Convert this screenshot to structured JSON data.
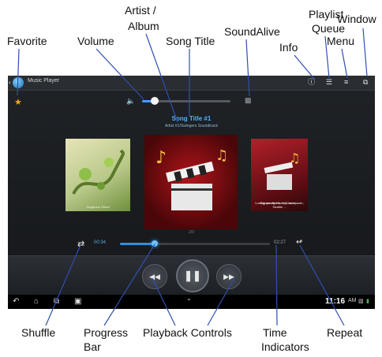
{
  "callouts": {
    "favorite": "Favorite",
    "volume": "Volume",
    "artist_album_1": "Artist /",
    "artist_album_2": "Album",
    "song_title": "Song Title",
    "soundalive": "SoundAlive",
    "playlist_1": "Playlist",
    "playlist_2": "Queue",
    "info": "Info",
    "menu": "Menu",
    "window": "Window",
    "shuffle": "Shuffle",
    "progress_bar_1": "Progress",
    "progress_bar_2": "Bar",
    "playback_controls": "Playback Controls",
    "time_indicators_1": "Time",
    "time_indicators_2": "Indicators",
    "repeat": "Repeat"
  },
  "app": {
    "title": "Music Player",
    "icons": {
      "back": "back-icon",
      "info": "info-icon",
      "playlist": "playlist-icon",
      "menu": "menu-icon",
      "window": "window-icon"
    }
  },
  "player": {
    "song_title": "Song Title #1",
    "artist_album": "Artist #1/Swingers Soundtrack",
    "volume_level": 0.14,
    "album_left_caption": "Gorgeous Green",
    "album_right_caption_1": "Symphony No. 9 (Choral ...",
    "album_right_caption_2": "Ludwig van Beethoven, composer; Seattle ...",
    "page_indicator": "2/3",
    "time_current": "00:34",
    "time_total": "02:27",
    "progress": 0.23
  },
  "status": {
    "clock": "11:16",
    "ampm": "AM"
  },
  "colors": {
    "accent": "#3aa0ff",
    "favorite": "#f5a623",
    "leader": "#2f4fb0"
  }
}
